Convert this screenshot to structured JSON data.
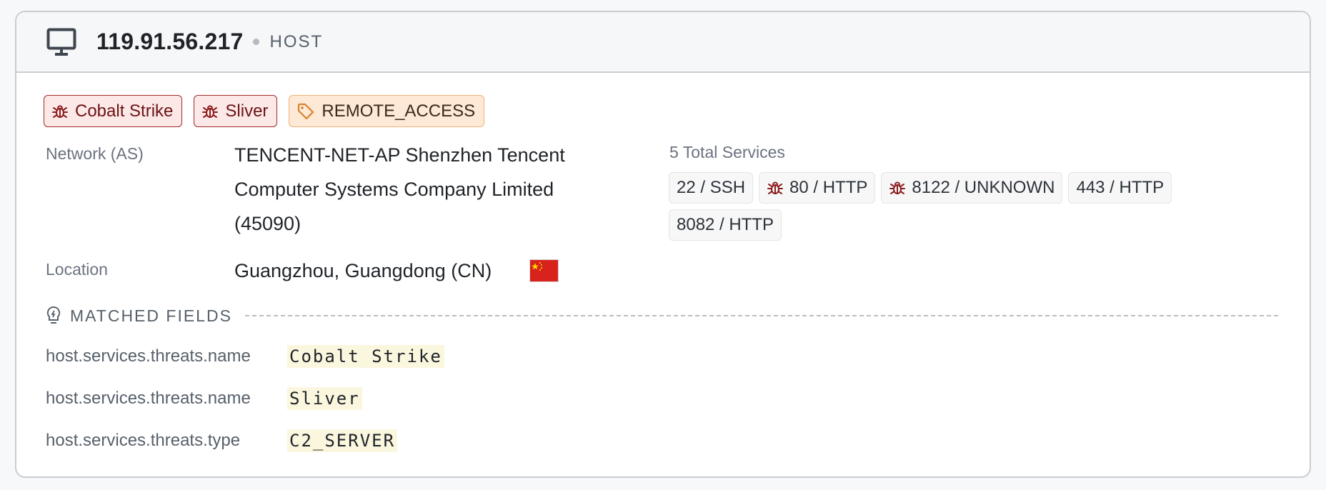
{
  "header": {
    "ip": "119.91.56.217",
    "type": "HOST",
    "icon": "monitor-icon"
  },
  "tags": [
    {
      "label": "Cobalt Strike",
      "kind": "threat",
      "icon": "bug-icon"
    },
    {
      "label": "Sliver",
      "kind": "threat",
      "icon": "bug-icon"
    },
    {
      "label": "REMOTE_ACCESS",
      "kind": "label",
      "icon": "tag-icon"
    }
  ],
  "network": {
    "label": "Network (AS)",
    "lines": [
      "TENCENT-NET-AP Shenzhen Tencent",
      "Computer Systems Company Limited",
      "(45090)"
    ]
  },
  "location": {
    "label": "Location",
    "value": "Guangzhou, Guangdong (CN)",
    "flag": "china-flag-icon"
  },
  "services": {
    "title": "5 Total Services",
    "items": [
      {
        "label": "22 / SSH",
        "threat": false
      },
      {
        "label": "80 / HTTP",
        "threat": true
      },
      {
        "label": "8122 / UNKNOWN",
        "threat": true
      },
      {
        "label": "443 / HTTP",
        "threat": false
      },
      {
        "label": "8082 / HTTP",
        "threat": false
      }
    ]
  },
  "matched_fields": {
    "title": "MATCHED FIELDS",
    "rows": [
      {
        "key": "host.services.threats.name",
        "value": "Cobalt Strike"
      },
      {
        "key": "host.services.threats.name",
        "value": "Sliver"
      },
      {
        "key": "host.services.threats.type",
        "value": "C2_SERVER"
      }
    ]
  },
  "colors": {
    "threat_bg": "#fde8e8",
    "threat_border": "#a12b2b",
    "label_bg": "#fde9d6",
    "label_border": "#f0b27a",
    "highlight": "#fbf7df"
  }
}
